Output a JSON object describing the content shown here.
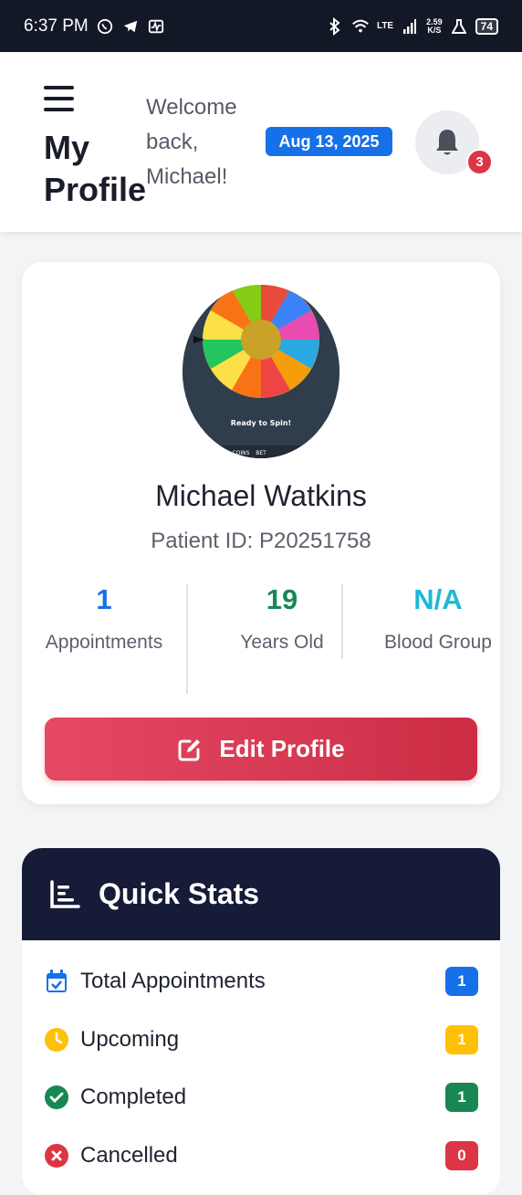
{
  "status_bar": {
    "time": "6:37 PM",
    "network_type": "LTE",
    "speed_value": "2.59",
    "speed_unit": "K/S",
    "battery": "74"
  },
  "header": {
    "title": "My Profile",
    "welcome": "Welcome back, Michael!",
    "date": "Aug 13, 2025",
    "notification_count": "3"
  },
  "profile": {
    "avatar_caption": "Ready to Spin!",
    "avatar_bottom_labels": [
      "IN",
      "COINS",
      "BET"
    ],
    "name": "Michael Watkins",
    "patient_id": "Patient ID: P20251758",
    "stats": [
      {
        "value": "1",
        "label": "Appointments",
        "color": "#1670e8"
      },
      {
        "value": "19",
        "label": "Years Old",
        "color": "#198754"
      },
      {
        "value": "N/A",
        "label": "Blood Group",
        "color": "#1eb8d6"
      }
    ],
    "edit_button": "Edit Profile"
  },
  "quick_stats": {
    "title": "Quick Stats",
    "items": [
      {
        "label": "Total Appointments",
        "count": "1",
        "icon": "calendar-check-icon",
        "color": "#1670e8"
      },
      {
        "label": "Upcoming",
        "count": "1",
        "icon": "clock-icon",
        "color": "#ffc107"
      },
      {
        "label": "Completed",
        "count": "1",
        "icon": "check-circle-icon",
        "color": "#198754"
      },
      {
        "label": "Cancelled",
        "count": "0",
        "icon": "x-circle-icon",
        "color": "#dc3545"
      }
    ]
  }
}
